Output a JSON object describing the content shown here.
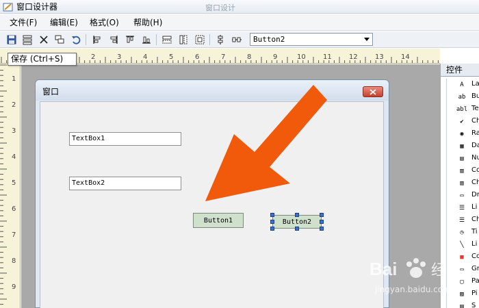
{
  "window": {
    "title": "窗口设计器",
    "background_title": "窗口设计"
  },
  "menu": [
    {
      "label": "文件(F)"
    },
    {
      "label": "编辑(E)"
    },
    {
      "label": "格式(O)"
    },
    {
      "label": "帮助(H)"
    }
  ],
  "toolbar": {
    "combo_value": "Button2",
    "tooltip": "保存 (Ctrl+S)",
    "icons": [
      "save-icon",
      "align-grid-icon",
      "delete-icon",
      "copy-icon",
      "undo-icon",
      "align-left-icon",
      "align-right-icon",
      "align-top-icon",
      "align-bottom-icon",
      "same-width-icon",
      "same-height-icon",
      "same-size-icon",
      "center-vertical-icon",
      "center-horizontal-icon"
    ]
  },
  "ruler": {
    "top_numbers": [
      "1",
      "2",
      "3",
      "4",
      "5",
      "6",
      "7",
      "8",
      "9",
      "10",
      "11",
      "12",
      "13",
      "14"
    ],
    "left_numbers": [
      "1",
      "2",
      "3",
      "4",
      "5",
      "6",
      "7",
      "8",
      "9"
    ]
  },
  "form": {
    "title": "窗口",
    "textbox1": "TextBox1",
    "textbox2": "TextBox2",
    "button1": "Button1",
    "button2": "Button2"
  },
  "panel": {
    "header": "控件",
    "tools": [
      {
        "icon": "A",
        "label": "La"
      },
      {
        "icon": "ab",
        "label": "Bu"
      },
      {
        "icon": "abl",
        "label": "Te"
      },
      {
        "icon": "✔",
        "label": "Ch"
      },
      {
        "icon": "◉",
        "label": "Ra"
      },
      {
        "icon": "▦",
        "label": "Da"
      },
      {
        "icon": "▤",
        "label": "Nu"
      },
      {
        "icon": "▥",
        "label": "Co"
      },
      {
        "icon": "▥",
        "label": "Ch"
      },
      {
        "icon": "▭",
        "label": "Dr"
      },
      {
        "icon": "☰",
        "label": "Li"
      },
      {
        "icon": "☰",
        "label": "Ch"
      },
      {
        "icon": "◷",
        "label": "Ti"
      },
      {
        "icon": "╲",
        "label": "Li"
      },
      {
        "icon": "■",
        "label": "Co"
      },
      {
        "icon": "▭",
        "label": "Gr"
      },
      {
        "icon": "▢",
        "label": "Pa"
      },
      {
        "icon": "▨",
        "label": "Pi"
      },
      {
        "icon": "▤",
        "label": "S"
      }
    ]
  },
  "watermark": {
    "brand": "Bai",
    "brand_cn": "经验",
    "url": "jingyan.baidu.com"
  },
  "colors": {
    "arrow": "#f05a0a",
    "close_button": "#c3412c",
    "button_fill": "#cfe0cd",
    "selection_handle": "#3b6fd0"
  }
}
